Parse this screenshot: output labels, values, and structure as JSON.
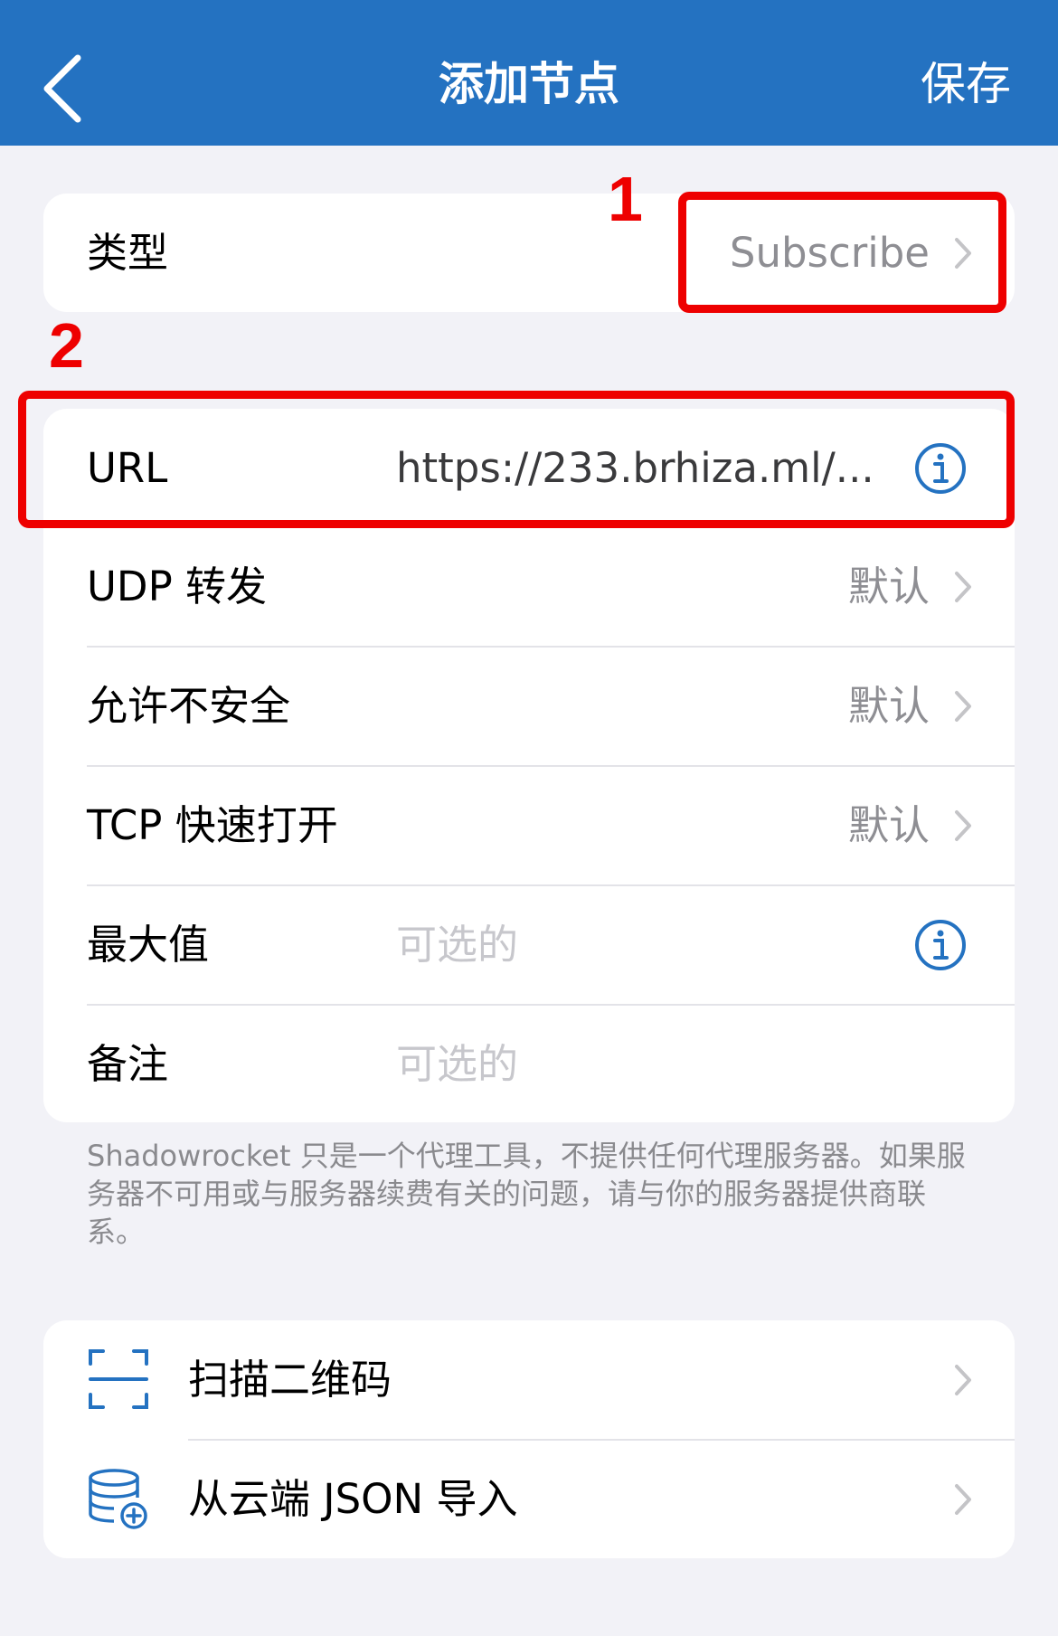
{
  "nav": {
    "title": "添加节点",
    "save_label": "保存"
  },
  "type_row": {
    "label": "类型",
    "value": "Subscribe"
  },
  "annotations": {
    "one": "1",
    "two": "2"
  },
  "url_row": {
    "label": "URL",
    "value": "https://233.brhiza.ml/..."
  },
  "settings": {
    "udp": {
      "label": "UDP 转发",
      "value": "默认"
    },
    "insecure": {
      "label": "允许不安全",
      "value": "默认"
    },
    "tcp_fast_open": {
      "label": "TCP 快速打开",
      "value": "默认"
    },
    "max": {
      "label": "最大值",
      "placeholder": "可选的"
    },
    "remark": {
      "label": "备注",
      "placeholder": "可选的"
    }
  },
  "footnote": "Shadowrocket 只是一个代理工具，不提供任何代理服务器。如果服务器不可用或与服务器续费有关的问题，请与你的服务器提供商联系。",
  "actions": {
    "scan_qr": {
      "label": "扫描二维码",
      "icon": "qr-scan-icon"
    },
    "import_json": {
      "label": "从云端 JSON 导入",
      "icon": "cloud-database-icon"
    }
  },
  "colors": {
    "nav_bg": "#2472c1",
    "accent": "#2472c1",
    "annotation": "#ee0000",
    "background": "#f2f2f7"
  }
}
